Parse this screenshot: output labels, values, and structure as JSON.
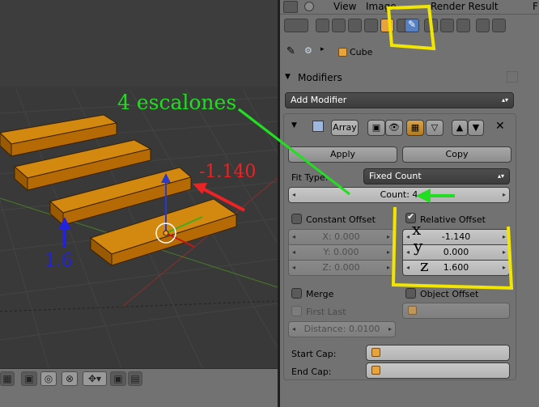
{
  "header_menu": {
    "view": "View",
    "image": "Image",
    "render_result": "Render Result",
    "f": "F"
  },
  "breadcrumb": {
    "object": "Cube"
  },
  "modifiers_panel": {
    "title": "Modifiers",
    "add_modifier": "Add Modifier",
    "modifier_name": "Array",
    "apply": "Apply",
    "copy": "Copy",
    "fit_type_label": "Fit Type:",
    "fit_type_value": "Fixed Count",
    "count": "Count: 4",
    "constant_offset": {
      "label": "Constant Offset",
      "checked": false,
      "x": "X: 0.000",
      "y": "Y: 0.000",
      "z": "Z: 0.000"
    },
    "relative_offset": {
      "label": "Relative Offset",
      "checked": true,
      "x": "-1.140",
      "y": "0.000",
      "z": "1.600"
    },
    "merge": {
      "label": "Merge",
      "checked": false
    },
    "first_last": {
      "label": "First Last",
      "checked": false
    },
    "distance": "Distance: 0.0100",
    "object_offset": {
      "label": "Object Offset",
      "checked": false
    },
    "start_cap_label": "Start Cap:",
    "end_cap_label": "End Cap:"
  },
  "annotations": {
    "steps": "4 escalones",
    "x_offset": "-1.140",
    "z_offset": "1.6",
    "axis_x": "x",
    "axis_y": "y",
    "axis_z": "z",
    "green": "#22dd22",
    "red": "#ee2222",
    "blue": "#2222dd",
    "yellow": "#f2e600"
  },
  "colors": {
    "panel_bg": "#727272",
    "viewport_bg": "#393939",
    "step_fill": "#c77806",
    "active_tab": "#5680c2"
  },
  "icons": [
    "info-icon",
    "layout-icon",
    "camera-icon",
    "render-layers-icon",
    "world-icon",
    "object-icon",
    "constraints-icon",
    "wrench-icon",
    "particles-icon",
    "texture-icon",
    "physics-icon",
    "pin-icon",
    "cube-icon",
    "eye-icon",
    "x-icon"
  ]
}
